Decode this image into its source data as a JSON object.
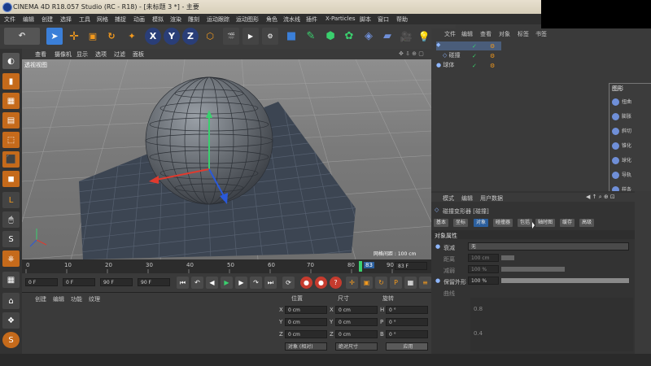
{
  "window": {
    "title": "CINEMA 4D R18.057 Studio (RC - R18) - [未标题 3 *] - 主要"
  },
  "menubar": [
    "文件",
    "编辑",
    "创建",
    "选择",
    "工具",
    "网格",
    "捕捉",
    "动画",
    "模拟",
    "渲染",
    "雕刻",
    "运动跟踪",
    "运动图形",
    "角色",
    "流水线",
    "插件",
    "X-Particles",
    "脚本",
    "窗口",
    "帮助"
  ],
  "toolbar": {
    "axes": [
      "X",
      "Y",
      "Z"
    ]
  },
  "viewport": {
    "menu": [
      "查看",
      "摄像机",
      "显示",
      "选项",
      "过滤",
      "面板"
    ],
    "label": "透视视图",
    "grid_spacing": "网格间距 : 100 cm"
  },
  "timeline": {
    "ticks": [
      "0",
      "10",
      "20",
      "30",
      "40",
      "50",
      "60",
      "70",
      "80",
      "90"
    ],
    "current_frame": "83",
    "end_field": "83 F"
  },
  "transport": {
    "start": "0 F",
    "cur": "0 F",
    "end": "90 F",
    "end2": "90 F"
  },
  "bottom_left": {
    "menu": [
      "创建",
      "编辑",
      "功能",
      "纹理"
    ]
  },
  "coord": {
    "headers": [
      "位置",
      "尺寸",
      "旋转"
    ],
    "rows": [
      {
        "axis": "X",
        "pos": "0 cm",
        "axis2": "X",
        "size": "0 cm",
        "rot_axis": "H",
        "rot": "0 °"
      },
      {
        "axis": "Y",
        "pos": "0 cm",
        "axis2": "Y",
        "size": "0 cm",
        "rot_axis": "P",
        "rot": "0 °"
      },
      {
        "axis": "Z",
        "pos": "0 cm",
        "axis2": "Z",
        "size": "0 cm",
        "rot_axis": "B",
        "rot": "0 °"
      }
    ],
    "mode": "对象 (相对)",
    "size_mode": "绝对尺寸",
    "apply": "应用"
  },
  "object_manager": {
    "menu": [
      "文件",
      "编辑",
      "查看",
      "对象",
      "标签",
      "书签"
    ],
    "items": [
      {
        "name": "",
        "depth": 0
      },
      {
        "name": "碰撞",
        "depth": 1
      },
      {
        "name": "球体",
        "depth": 0
      }
    ]
  },
  "palette": {
    "title": "图形",
    "items": [
      "扭曲",
      "膨胀",
      "斜切",
      "锥化",
      "螺旋",
      "FFD",
      "网格",
      "挤压&伸展",
      "融解",
      "爆炸",
      "破碎"
    ],
    "visible_items": [
      "扭曲",
      "膨胀",
      "斜切",
      "锥化",
      "球化",
      "导轨",
      "样条",
      "平滑"
    ]
  },
  "attributes": {
    "menu": [
      "模式",
      "编辑",
      "用户数据"
    ],
    "object_title": "碰撞变形器 [碰撞]",
    "tabs": [
      "基本",
      "坐标",
      "对象",
      "碰撞器",
      "包括",
      "缓存",
      "高级"
    ],
    "active_tab": "对象",
    "tab_cut": "轴时图",
    "section": "对象属性",
    "fields": [
      {
        "label": "衰减",
        "value": "无"
      },
      {
        "label": "距离",
        "value": "100 cm"
      },
      {
        "label": "减弱",
        "value": "100 %"
      },
      {
        "label": "保留外形",
        "value": "100 %"
      },
      {
        "label": "曲线",
        "value": ""
      }
    ],
    "graph_ticks": [
      "0.8",
      "0.4"
    ]
  },
  "colors": {
    "accent_orange": "#f39a1e",
    "blue_icon": "#3b7fd8",
    "grid_green": "#3ad06e",
    "sphere": "#6f747a"
  }
}
